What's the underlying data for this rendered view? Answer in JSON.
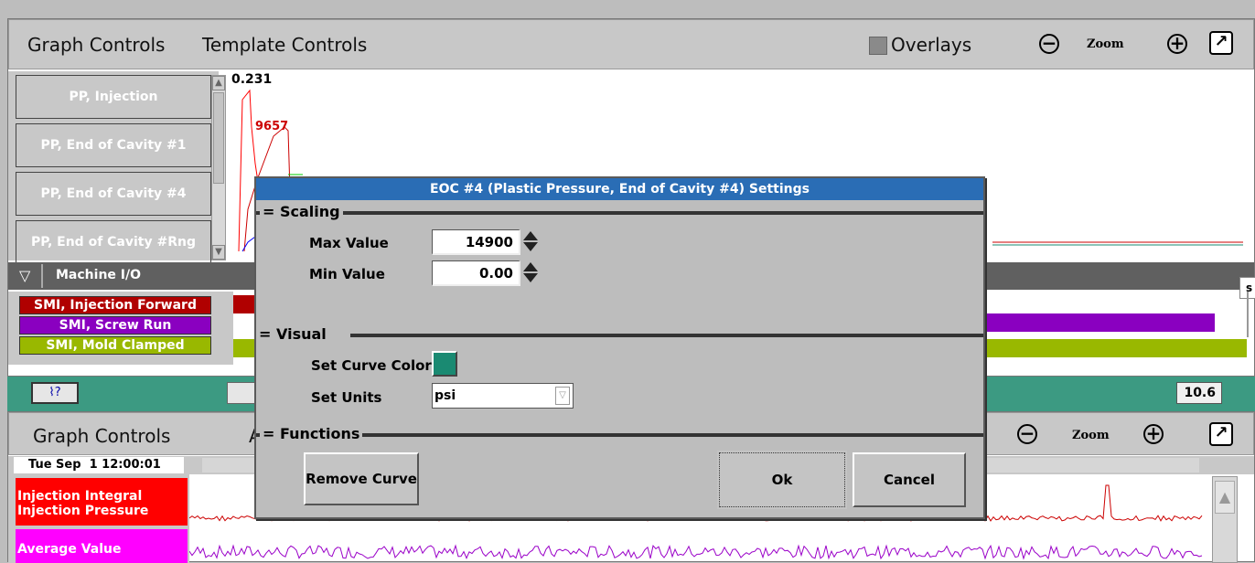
{
  "top_panel": {
    "menu_graph_controls": "Graph Controls",
    "menu_template_controls": "Template Controls",
    "overlays_label": "Overlays",
    "zoom_label": "Zoom",
    "curve_buttons": [
      {
        "label": "PP, Injection",
        "color": "#ff0000"
      },
      {
        "label": "PP, End of Cavity #1",
        "color": "#0000ff"
      },
      {
        "label": "PP, End of Cavity #4",
        "color": "#1a8a72"
      },
      {
        "label": "PP, End of Cavity #Rng",
        "color": "#ff00ff"
      }
    ],
    "y_max_label": "0.231",
    "curve_peak_label": "9657",
    "machine_io_label": "Machine I/O",
    "io_buttons": [
      {
        "label": "SMI, Injection Forward",
        "color": "#b00000"
      },
      {
        "label": "SMI, Screw Run",
        "color": "#8a00c0"
      },
      {
        "label": "SMI, Mold Clamped",
        "color": "#99b800"
      }
    ],
    "edge_label": "s"
  },
  "status_bar": {
    "readout": "10.6"
  },
  "dialog": {
    "title": "EOC #4 (Plastic Pressure, End of Cavity #4) Settings",
    "scaling_header": "Scaling",
    "max_value_label": "Max Value",
    "max_value": "14900",
    "min_value_label": "Min Value",
    "min_value": "0.00",
    "visual_header": "Visual",
    "curve_color_label": "Set Curve Color",
    "curve_color": "#1a8a72",
    "units_label": "Set Units",
    "units_value": "psi",
    "functions_header": "Functions",
    "remove_curve_label": "Remove Curve",
    "ok_label": "Ok",
    "cancel_label": "Cancel"
  },
  "bottom_panel": {
    "menu_graph_controls": "Graph Controls",
    "menu_partial": "A",
    "zoom_label": "Zoom",
    "timestamp": "Tue Sep  1 12:00:01",
    "curve_buttons": [
      {
        "label": "Injection Integral Injection Pressure",
        "color": "#ff0000"
      },
      {
        "label": "Average Value",
        "color": "#ff00ff"
      }
    ]
  }
}
